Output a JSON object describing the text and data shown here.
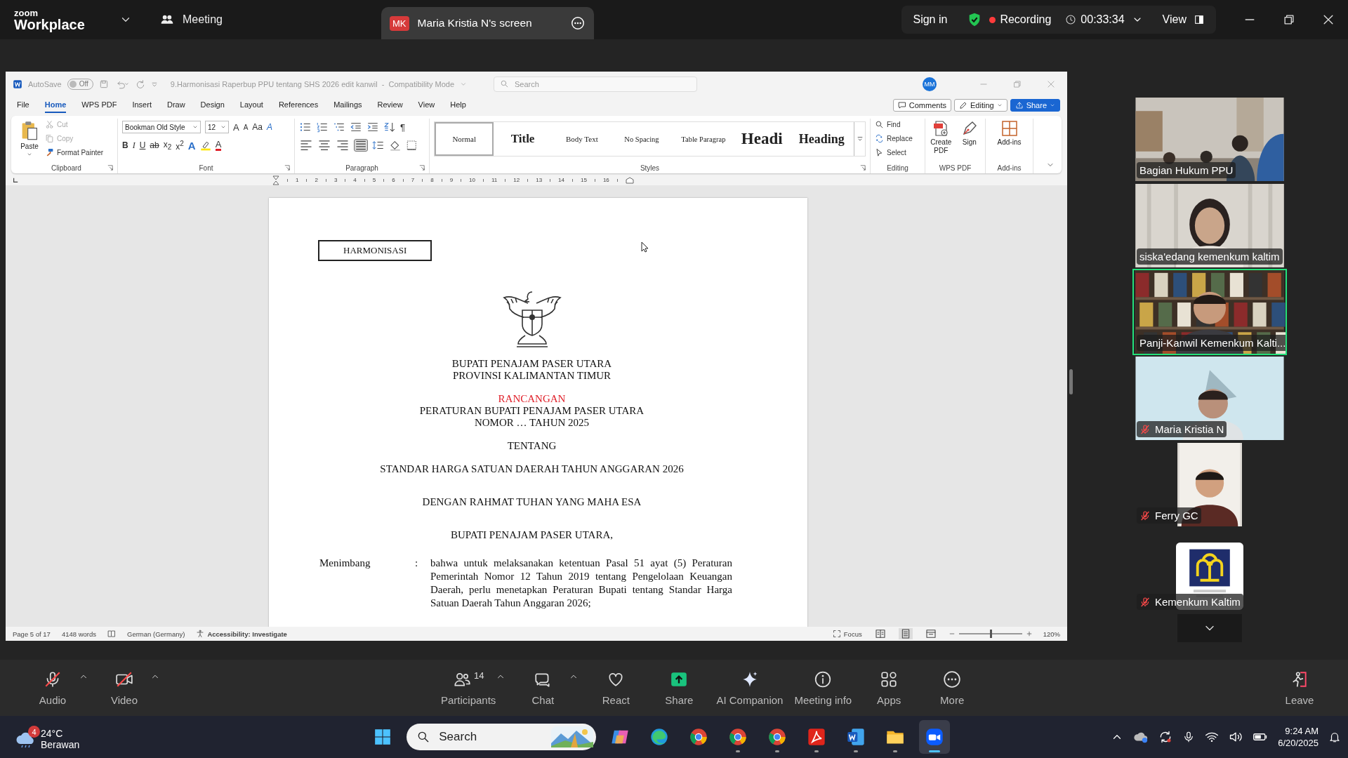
{
  "zoom_bar": {
    "brand": "zoom",
    "app_name": "Workplace",
    "meeting_label": "Meeting",
    "share_tab": {
      "initials": "MK",
      "title": "Maria Kristia N's screen"
    },
    "sign_in": "Sign in",
    "recording": "Recording",
    "timer": "00:33:34",
    "view": "View"
  },
  "word": {
    "autosave": "AutoSave",
    "autosave_state": "Off",
    "autosave_on": false,
    "title": "9.Harmonisasi Raperbup PPU tentang SHS 2026 edit kanwil  -  Compatibility Mode",
    "search_placeholder": "Search",
    "account": "MM",
    "menu_tabs": [
      {
        "label": "File",
        "selected": false
      },
      {
        "label": "Home",
        "selected": true
      },
      {
        "label": "WPS PDF",
        "selected": false
      },
      {
        "label": "Insert",
        "selected": false
      },
      {
        "label": "Draw",
        "selected": false
      },
      {
        "label": "Design",
        "selected": false
      },
      {
        "label": "Layout",
        "selected": false
      },
      {
        "label": "References",
        "selected": false
      },
      {
        "label": "Mailings",
        "selected": false
      },
      {
        "label": "Review",
        "selected": false
      },
      {
        "label": "View",
        "selected": false
      },
      {
        "label": "Help",
        "selected": false
      }
    ],
    "comments": "Comments",
    "editing": "Editing",
    "share": "Share",
    "ribbon": {
      "clipboard": {
        "label": "Clipboard",
        "paste": "Paste",
        "items": [
          {
            "kind": "cut",
            "label": "Cut",
            "disabled": true
          },
          {
            "kind": "copy",
            "label": "Copy",
            "disabled": true
          },
          {
            "kind": "painter",
            "label": "Format Painter",
            "disabled": false
          }
        ]
      },
      "font": {
        "label": "Font",
        "font_name": "Bookman Old Style",
        "font_size": "12",
        "top_tools": [
          {
            "kind": "grow",
            "text": "A"
          },
          {
            "kind": "shrink",
            "text": "A"
          },
          {
            "kind": "case",
            "text": "Aa"
          },
          {
            "kind": "clear",
            "text": "A"
          }
        ],
        "format_tools": [
          {
            "kind": "bold",
            "text": "B"
          },
          {
            "kind": "italic",
            "text": "I"
          },
          {
            "kind": "underline",
            "text": "U"
          },
          {
            "kind": "strike",
            "text": "ab"
          },
          {
            "kind": "sub",
            "text": "x$_{2}$"
          },
          {
            "kind": "sup",
            "text": "x$^{2}$"
          },
          {
            "kind": "effects",
            "text": "A"
          },
          {
            "kind": "highlight"
          },
          {
            "kind": "color",
            "text": "A"
          }
        ]
      },
      "paragraph": {
        "label": "Paragraph",
        "pilcrow": "¶",
        "align": [
          {
            "kind": "left",
            "selected": false
          },
          {
            "kind": "center",
            "selected": false
          },
          {
            "kind": "right",
            "selected": false
          },
          {
            "kind": "justify",
            "selected": true
          }
        ]
      },
      "styles": {
        "label": "Styles",
        "items": [
          {
            "kind": "normal",
            "label": "Normal",
            "selected": true
          },
          {
            "kind": "title",
            "label": "Title",
            "selected": false
          },
          {
            "kind": "body",
            "label": "Body Text",
            "selected": false
          },
          {
            "kind": "nospacing",
            "label": "No Spacing",
            "selected": false
          },
          {
            "kind": "table",
            "label": "Table Paragrap",
            "selected": false
          },
          {
            "kind": "heading1",
            "label": "Headi",
            "selected": false
          },
          {
            "kind": "heading2",
            "label": "Heading",
            "selected": false
          }
        ]
      },
      "editing": {
        "label": "Editing",
        "items": [
          {
            "kind": "find",
            "label": "Find"
          },
          {
            "kind": "replace",
            "label": "Replace"
          },
          {
            "kind": "select",
            "label": "Select"
          }
        ]
      },
      "wps_pdf": {
        "label": "WPS PDF",
        "items": [
          {
            "kind": "create_pdf",
            "label": "Create PDF"
          },
          {
            "kind": "sign",
            "label": "Sign"
          }
        ]
      },
      "addins": {
        "label": "Add-ins",
        "button": "Add-ins"
      }
    },
    "ruler_marks": [
      "1",
      "2",
      "3",
      "4",
      "5",
      "6",
      "7",
      "8",
      "9",
      "10",
      "11",
      "12",
      "13",
      "14",
      "15",
      "16"
    ],
    "document": {
      "blocks": [
        {
          "kind": "boxed",
          "lines": [
            {
              "text": "HARMONISASI"
            }
          ]
        },
        {
          "kind": "emblem"
        },
        {
          "kind": "center",
          "lines": [
            {
              "text": "BUPATI PENAJAM PASER UTARA"
            },
            {
              "text": "PROVINSI KALIMANTAN TIMUR"
            }
          ]
        },
        {
          "kind": "center",
          "lines": [
            {
              "text": "RANCANGAN",
              "color": "#e0202a"
            },
            {
              "text": "PERATURAN BUPATI PENAJAM PASER UTARA"
            },
            {
              "text": "NOMOR … TAHUN 2025"
            }
          ]
        },
        {
          "kind": "center",
          "lines": [
            {
              "text": "TENTANG"
            }
          ]
        },
        {
          "kind": "center",
          "lines": [
            {
              "text": "STANDAR HARGA SATUAN DAERAH TAHUN ANGGARAN 2026"
            }
          ]
        },
        {
          "kind": "center",
          "lines": [
            {
              "text": "DENGAN RAHMAT TUHAN YANG MAHA ESA"
            }
          ]
        },
        {
          "kind": "center",
          "lines": [
            {
              "text": "BUPATI PENAJAM PASER UTARA,"
            }
          ]
        },
        {
          "kind": "clause",
          "label": "Menimbang",
          "separator": ":",
          "text": "bahwa untuk melaksanakan ketentuan Pasal 51 ayat (5) Peraturan Pemerintah Nomor 12 Tahun 2019 tentang Pengelolaan Keuangan Daerah, perlu menetapkan Peraturan Bupati tentang Standar Harga Satuan Daerah Tahun Anggaran 2026;"
        }
      ]
    },
    "status_bar": {
      "page": "Page 5 of 17",
      "words": "4148 words",
      "language": "German (Germany)",
      "accessibility": "Accessibility: Investigate",
      "focus": "Focus",
      "views": [
        {
          "kind": "read",
          "selected": false
        },
        {
          "kind": "print",
          "selected": true
        },
        {
          "kind": "web",
          "selected": false
        }
      ],
      "level": 0.5,
      "zoom": "120%"
    }
  },
  "participants": [
    {
      "name": "Bagian Hukum PPU",
      "kind": "wide",
      "muted": false,
      "active": false
    },
    {
      "name": "siska'edang kemenkum kaltim",
      "kind": "wide",
      "muted": false,
      "active": false
    },
    {
      "name": "Panji-Kanwil Kemenkum Kalti...",
      "kind": "wide",
      "muted": false,
      "active": true
    },
    {
      "name": "Maria Kristia N",
      "kind": "wide",
      "muted": true,
      "active": false
    },
    {
      "name": "Ferry GC",
      "kind": "portrait",
      "muted": true,
      "active": false
    },
    {
      "name": "Kemenkum Kaltim",
      "kind": "logo",
      "muted": true,
      "active": false
    }
  ],
  "toolbar": {
    "left": [
      {
        "kind": "audio",
        "label": "Audio",
        "off": true,
        "caret": true
      },
      {
        "kind": "video",
        "label": "Video",
        "off": true,
        "caret": true
      }
    ],
    "center": [
      {
        "kind": "participants",
        "label": "Participants",
        "count": "14",
        "caret": true
      },
      {
        "kind": "chat",
        "label": "Chat",
        "caret": true
      },
      {
        "kind": "react",
        "label": "React"
      },
      {
        "kind": "share",
        "label": "Share"
      },
      {
        "kind": "ai",
        "label": "AI Companion"
      },
      {
        "kind": "info",
        "label": "Meeting info"
      },
      {
        "kind": "apps",
        "label": "Apps"
      },
      {
        "kind": "more",
        "label": "More"
      }
    ],
    "right": [
      {
        "kind": "leave",
        "label": "Leave"
      }
    ]
  },
  "taskbar": {
    "weather": {
      "badge": "4",
      "temperature": "24°C",
      "condition": "Berawan"
    },
    "search_placeholder": "Search",
    "apps": [
      {
        "kind": "copilot",
        "open": false,
        "active": false
      },
      {
        "kind": "edge",
        "open": false,
        "active": false
      },
      {
        "kind": "chrome",
        "open": false,
        "active": false
      },
      {
        "kind": "chrome",
        "open": true,
        "active": false
      },
      {
        "kind": "chrome",
        "open": true,
        "active": false
      },
      {
        "kind": "acrobat",
        "open": true,
        "active": false
      },
      {
        "kind": "word",
        "open": true,
        "active": false
      },
      {
        "kind": "explorer",
        "open": true,
        "active": false
      },
      {
        "kind": "zoom",
        "open": true,
        "active": true
      }
    ],
    "time": "9:24 AM",
    "date": "6/20/2025"
  }
}
